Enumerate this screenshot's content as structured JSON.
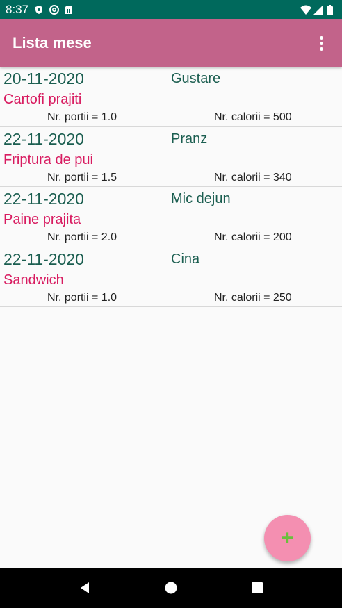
{
  "status_bar": {
    "time": "8:37"
  },
  "app_bar": {
    "title": "Lista mese"
  },
  "meals": [
    {
      "date": "20-11-2020",
      "type": "Gustare",
      "food": "Cartofi prajiti",
      "portii": "Nr. portii = 1.0",
      "calorii": "Nr. calorii = 500"
    },
    {
      "date": "22-11-2020",
      "type": "Pranz",
      "food": "Friptura de pui",
      "portii": "Nr. portii = 1.5",
      "calorii": "Nr. calorii = 340"
    },
    {
      "date": "22-11-2020",
      "type": "Mic dejun",
      "food": "Paine prajita",
      "portii": "Nr. portii = 2.0",
      "calorii": "Nr. calorii = 200"
    },
    {
      "date": "22-11-2020",
      "type": "Cina",
      "food": "Sandwich",
      "portii": "Nr. portii = 1.0",
      "calorii": "Nr. calorii = 250"
    }
  ],
  "fab": {
    "label": "+"
  },
  "icons": {
    "status": [
      "shield-icon",
      "at-icon",
      "sim-card-icon",
      "wifi-icon",
      "signal-icon",
      "battery-icon"
    ],
    "app_bar": "more-vert-icon",
    "nav": [
      "back-icon",
      "home-icon",
      "recents-icon"
    ]
  },
  "colors": {
    "status_bar": "#00695c",
    "app_bar": "#c2638a",
    "date_text": "#1b5e50",
    "food_text": "#d81b60",
    "fab": "#f48fb1",
    "fab_icon": "#6abf3d"
  }
}
